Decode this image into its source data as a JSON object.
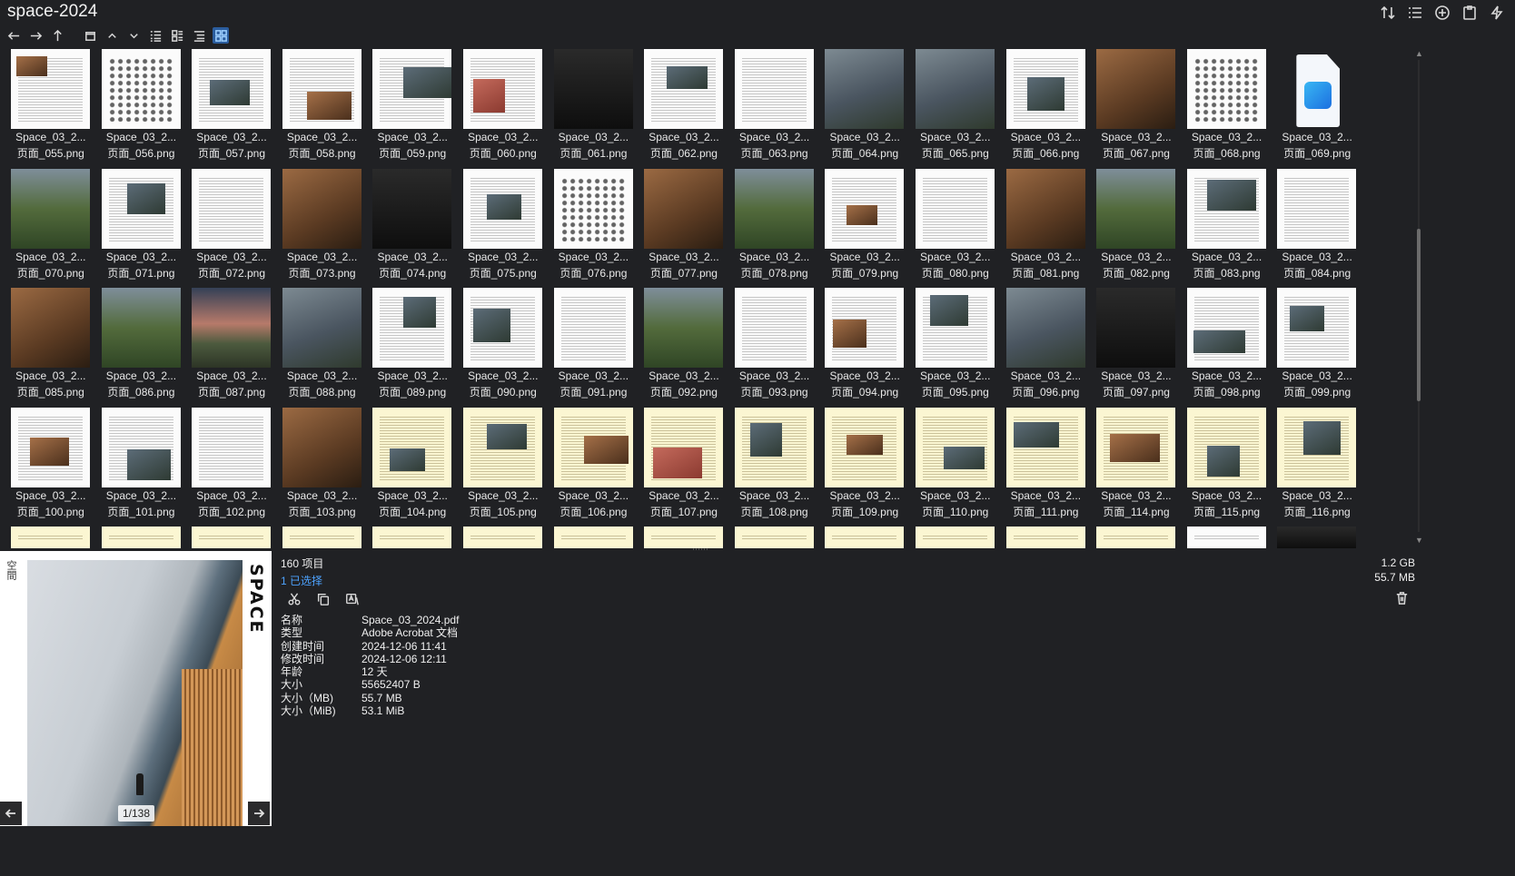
{
  "window": {
    "title": "space-2024"
  },
  "toolbar_right": [
    {
      "icon": "sort-icon"
    },
    {
      "icon": "list-settings-icon"
    },
    {
      "icon": "add-circle-icon"
    },
    {
      "icon": "clipboard-icon"
    },
    {
      "icon": "lightning-icon"
    }
  ],
  "nav": [
    {
      "icon": "back-arrow-icon"
    },
    {
      "icon": "forward-arrow-icon"
    },
    {
      "icon": "up-arrow-icon"
    },
    {
      "icon": "window-icon"
    },
    {
      "icon": "chevron-up-icon"
    },
    {
      "icon": "chevron-down-icon"
    },
    {
      "icon": "details-view-icon"
    },
    {
      "icon": "tiles-view-icon"
    },
    {
      "icon": "list-view-icon"
    },
    {
      "icon": "thumbnails-view-icon",
      "active": true
    }
  ],
  "files": [
    {
      "name": "Space_03_2...",
      "page": "页面_055.png",
      "style": "doc-pic"
    },
    {
      "name": "Space_03_2...",
      "page": "页面_056.png",
      "style": "map"
    },
    {
      "name": "Space_03_2...",
      "page": "页面_057.png",
      "style": "doc-pic"
    },
    {
      "name": "Space_03_2...",
      "page": "页面_058.png",
      "style": "doc-pic"
    },
    {
      "name": "Space_03_2...",
      "page": "页面_059.png",
      "style": "doc-pic"
    },
    {
      "name": "Space_03_2...",
      "page": "页面_060.png",
      "style": "doc-red"
    },
    {
      "name": "Space_03_2...",
      "page": "页面_061.png",
      "style": "dark"
    },
    {
      "name": "Space_03_2...",
      "page": "页面_062.png",
      "style": "doc-pic"
    },
    {
      "name": "Space_03_2...",
      "page": "页面_063.png",
      "style": "doc"
    },
    {
      "name": "Space_03_2...",
      "page": "页面_064.png",
      "style": "photo"
    },
    {
      "name": "Space_03_2...",
      "page": "页面_065.png",
      "style": "photo"
    },
    {
      "name": "Space_03_2...",
      "page": "页面_066.png",
      "style": "doc-pic"
    },
    {
      "name": "Space_03_2...",
      "page": "页面_067.png",
      "style": "warm"
    },
    {
      "name": "Space_03_2...",
      "page": "页面_068.png",
      "style": "map"
    },
    {
      "name": "Space_03_2...",
      "page": "页面_069.png",
      "style": "image-icon"
    },
    {
      "name": "Space_03_2...",
      "page": "页面_070.png",
      "style": "green"
    },
    {
      "name": "Space_03_2...",
      "page": "页面_071.png",
      "style": "doc-pic"
    },
    {
      "name": "Space_03_2...",
      "page": "页面_072.png",
      "style": "doc"
    },
    {
      "name": "Space_03_2...",
      "page": "页面_073.png",
      "style": "warm"
    },
    {
      "name": "Space_03_2...",
      "page": "页面_074.png",
      "style": "dark"
    },
    {
      "name": "Space_03_2...",
      "page": "页面_075.png",
      "style": "doc-pic"
    },
    {
      "name": "Space_03_2...",
      "page": "页面_076.png",
      "style": "map"
    },
    {
      "name": "Space_03_2...",
      "page": "页面_077.png",
      "style": "warm"
    },
    {
      "name": "Space_03_2...",
      "page": "页面_078.png",
      "style": "green"
    },
    {
      "name": "Space_03_2...",
      "page": "页面_079.png",
      "style": "doc-pic"
    },
    {
      "name": "Space_03_2...",
      "page": "页面_080.png",
      "style": "doc"
    },
    {
      "name": "Space_03_2...",
      "page": "页面_081.png",
      "style": "warm"
    },
    {
      "name": "Space_03_2...",
      "page": "页面_082.png",
      "style": "green"
    },
    {
      "name": "Space_03_2...",
      "page": "页面_083.png",
      "style": "doc-pic"
    },
    {
      "name": "Space_03_2...",
      "page": "页面_084.png",
      "style": "doc"
    },
    {
      "name": "Space_03_2...",
      "page": "页面_085.png",
      "style": "warm"
    },
    {
      "name": "Space_03_2...",
      "page": "页面_086.png",
      "style": "green"
    },
    {
      "name": "Space_03_2...",
      "page": "页面_087.png",
      "style": "sunset"
    },
    {
      "name": "Space_03_2...",
      "page": "页面_088.png",
      "style": "photo"
    },
    {
      "name": "Space_03_2...",
      "page": "页面_089.png",
      "style": "doc-pic"
    },
    {
      "name": "Space_03_2...",
      "page": "页面_090.png",
      "style": "doc-pic"
    },
    {
      "name": "Space_03_2...",
      "page": "页面_091.png",
      "style": "doc"
    },
    {
      "name": "Space_03_2...",
      "page": "页面_092.png",
      "style": "green"
    },
    {
      "name": "Space_03_2...",
      "page": "页面_093.png",
      "style": "doc"
    },
    {
      "name": "Space_03_2...",
      "page": "页面_094.png",
      "style": "doc-pic"
    },
    {
      "name": "Space_03_2...",
      "page": "页面_095.png",
      "style": "doc-pic"
    },
    {
      "name": "Space_03_2...",
      "page": "页面_096.png",
      "style": "photo"
    },
    {
      "name": "Space_03_2...",
      "page": "页面_097.png",
      "style": "dark"
    },
    {
      "name": "Space_03_2...",
      "page": "页面_098.png",
      "style": "doc-pic"
    },
    {
      "name": "Space_03_2...",
      "page": "页面_099.png",
      "style": "doc-pic"
    },
    {
      "name": "Space_03_2...",
      "page": "页面_100.png",
      "style": "doc-pic"
    },
    {
      "name": "Space_03_2...",
      "page": "页面_101.png",
      "style": "doc-pic"
    },
    {
      "name": "Space_03_2...",
      "page": "页面_102.png",
      "style": "doc"
    },
    {
      "name": "Space_03_2...",
      "page": "页面_103.png",
      "style": "warm"
    },
    {
      "name": "Space_03_2...",
      "page": "页面_104.png",
      "style": "cream-pic"
    },
    {
      "name": "Space_03_2...",
      "page": "页面_105.png",
      "style": "cream-pic"
    },
    {
      "name": "Space_03_2...",
      "page": "页面_106.png",
      "style": "cream-pic"
    },
    {
      "name": "Space_03_2...",
      "page": "页面_107.png",
      "style": "cream-red"
    },
    {
      "name": "Space_03_2...",
      "page": "页面_108.png",
      "style": "cream-pic"
    },
    {
      "name": "Space_03_2...",
      "page": "页面_109.png",
      "style": "cream-pic"
    },
    {
      "name": "Space_03_2...",
      "page": "页面_110.png",
      "style": "cream-pic"
    },
    {
      "name": "Space_03_2...",
      "page": "页面_111.png",
      "style": "cream-pic"
    },
    {
      "name": "Space_03_2...",
      "page": "页面_114.png",
      "style": "cream-pic"
    },
    {
      "name": "Space_03_2...",
      "page": "页面_115.png",
      "style": "cream-pic"
    },
    {
      "name": "Space_03_2...",
      "page": "页面_116.png",
      "style": "cream-pic"
    },
    {
      "name": "",
      "page": "",
      "style": "cream-pic"
    },
    {
      "name": "",
      "page": "",
      "style": "cream"
    },
    {
      "name": "",
      "page": "",
      "style": "cream"
    },
    {
      "name": "",
      "page": "",
      "style": "cream-pic"
    },
    {
      "name": "",
      "page": "",
      "style": "cream"
    },
    {
      "name": "",
      "page": "",
      "style": "cream"
    },
    {
      "name": "",
      "page": "",
      "style": "cream"
    },
    {
      "name": "",
      "page": "",
      "style": "cream"
    },
    {
      "name": "",
      "page": "",
      "style": "cream"
    },
    {
      "name": "",
      "page": "",
      "style": "cream"
    },
    {
      "name": "",
      "page": "",
      "style": "cream"
    },
    {
      "name": "",
      "page": "",
      "style": "cream"
    },
    {
      "name": "",
      "page": "",
      "style": "cream"
    },
    {
      "name": "",
      "page": "",
      "style": "doc"
    },
    {
      "name": "",
      "page": "",
      "style": "dark"
    }
  ],
  "preview": {
    "page_indicator": "1/138",
    "cover_brand": "SPACE",
    "cover_side_text": "空間"
  },
  "status": {
    "item_count": "160 项目",
    "selected": "1 已选择",
    "total_size": "1.2 GB",
    "selected_size": "55.7 MB"
  },
  "actions": [
    {
      "icon": "cut-icon"
    },
    {
      "icon": "copy-icon"
    },
    {
      "icon": "translate-icon"
    }
  ],
  "properties": [
    {
      "key": "名称",
      "value": "Space_03_2024.pdf"
    },
    {
      "key": "类型",
      "value": "Adobe Acrobat 文档"
    },
    {
      "key": "创建时间",
      "value": "2024-12-06  11:41"
    },
    {
      "key": "修改时间",
      "value": "2024-12-06  12:11"
    },
    {
      "key": "年龄",
      "value": "12 天"
    },
    {
      "key": "大小",
      "value": "55652407 B"
    },
    {
      "key": "大小（MB)",
      "value": "55.7 MB"
    },
    {
      "key": "大小（MiB)",
      "value": "53.1 MiB"
    }
  ],
  "colors": {
    "background": "#202124",
    "accent": "#4da3ff",
    "active_view": "#2b5d9e"
  }
}
